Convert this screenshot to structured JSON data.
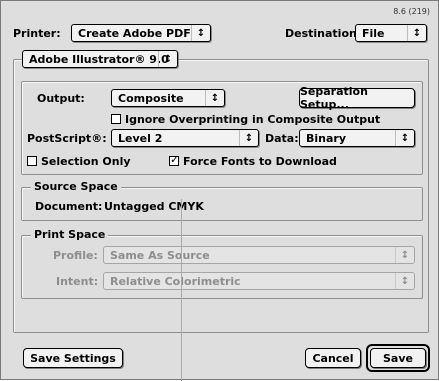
{
  "header": {
    "version": "8.6 (219)",
    "printer_label": "Printer:",
    "printer_value": "Create Adobe PDF",
    "destination_label": "Destination:",
    "destination_value": "File"
  },
  "panel_popup": {
    "value": "Adobe Illustrator® 9.0"
  },
  "output_section": {
    "output_label": "Output:",
    "output_value": "Composite",
    "separation_button": "Separation Setup...",
    "ignore_overprinting": {
      "label": "Ignore Overprinting in Composite Output",
      "checked": false
    },
    "postscript_label": "PostScript®:",
    "postscript_value": "Level 2",
    "data_label": "Data:",
    "data_value": "Binary",
    "selection_only": {
      "label": "Selection Only",
      "checked": false
    },
    "force_fonts": {
      "label": "Force Fonts to Download",
      "checked": true,
      "mark": "✓"
    }
  },
  "source_space": {
    "title": "Source Space",
    "document_label": "Document:",
    "document_value": "Untagged CMYK"
  },
  "print_space": {
    "title": "Print Space",
    "profile_label": "Profile:",
    "profile_value": "Same As Source",
    "intent_label": "Intent:",
    "intent_value": "Relative Colorimetric"
  },
  "footer": {
    "save_settings": "Save Settings",
    "cancel": "Cancel",
    "save": "Save"
  },
  "icons": {
    "popup_arrows": "↕"
  },
  "colors": {
    "overlay_line": "#5fd97a"
  }
}
